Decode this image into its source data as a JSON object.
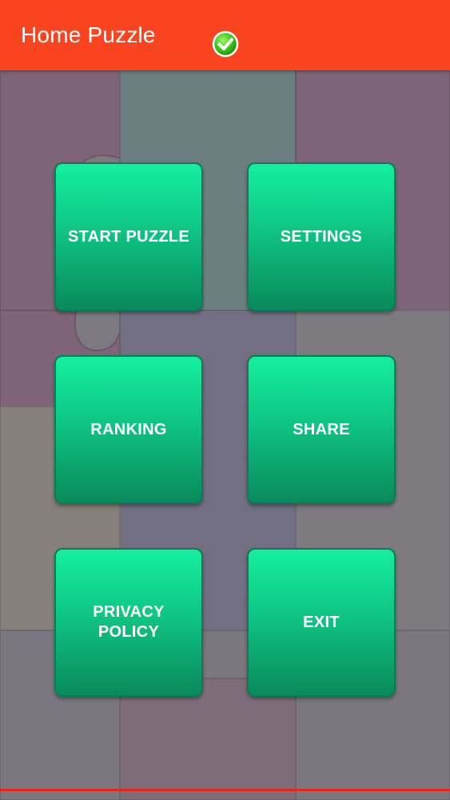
{
  "app": {
    "title": "Home Puzzle",
    "status_icon": "check-circle-icon",
    "bar_color": "#fa4420"
  },
  "menu": {
    "buttons": [
      {
        "label": "START PUZZLE"
      },
      {
        "label": "SETTINGS"
      },
      {
        "label": "RANKING"
      },
      {
        "label": "SHARE"
      },
      {
        "label": "PRIVACY\nPOLICY"
      },
      {
        "label": "EXIT"
      }
    ],
    "button_color": "#0fc585"
  },
  "background": {
    "pattern": "puzzle-pieces",
    "colors": [
      "#7f6073",
      "#6a7f80",
      "#7a7880",
      "#8c8478",
      "#6d6480"
    ]
  }
}
